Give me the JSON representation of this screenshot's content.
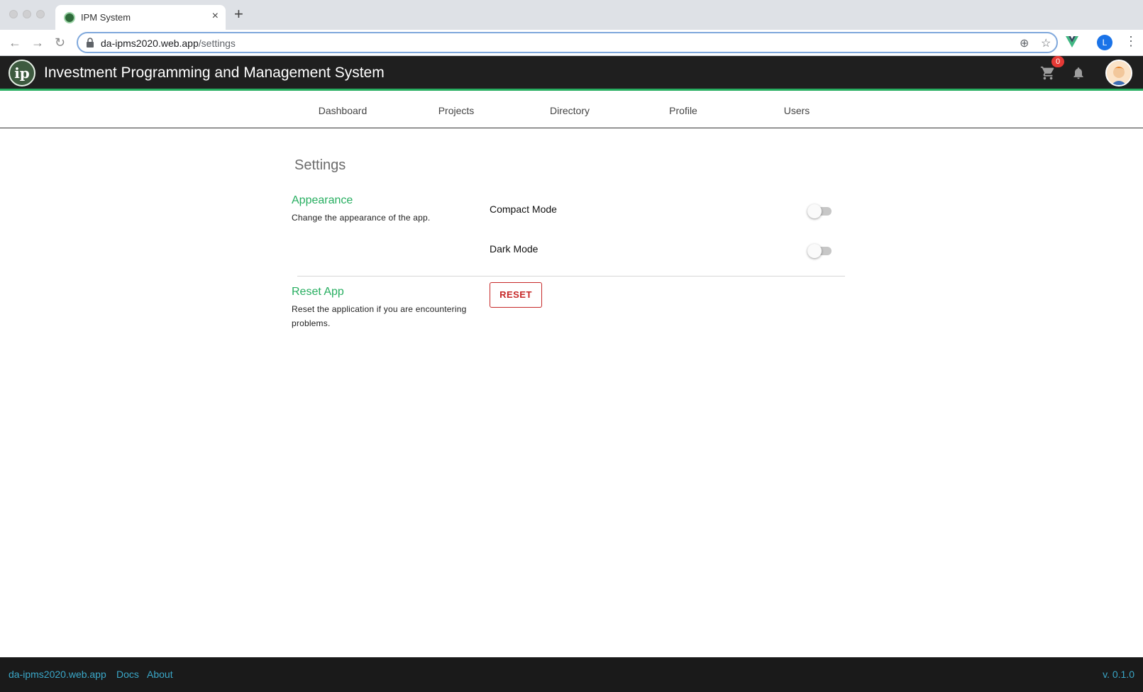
{
  "browser": {
    "tab_title": "IPM System",
    "new_tab_symbol": "+",
    "close_symbol": "×",
    "url_host": "da-ipms2020.web.app",
    "url_path": "/settings",
    "profile_initial": "L"
  },
  "header": {
    "logo_text": "ip",
    "title": "Investment Programming and Management System",
    "cart_count": "0"
  },
  "nav": {
    "items": [
      {
        "label": "Dashboard"
      },
      {
        "label": "Projects"
      },
      {
        "label": "Directory"
      },
      {
        "label": "Profile"
      },
      {
        "label": "Users"
      }
    ]
  },
  "settings": {
    "title": "Settings",
    "appearance": {
      "title": "Appearance",
      "description": "Change the appearance of the app.",
      "compact_mode_label": "Compact Mode",
      "compact_mode_on": false,
      "dark_mode_label": "Dark Mode",
      "dark_mode_on": false
    },
    "reset": {
      "title": "Reset App",
      "description": "Reset the application if you are encountering problems.",
      "button_label": "RESET"
    }
  },
  "footer": {
    "links": [
      {
        "label": "da-ipms2020.web.app"
      },
      {
        "label": "Docs"
      },
      {
        "label": "About"
      }
    ],
    "version": "v. 0.1.0"
  },
  "colors": {
    "accent_green": "#27ae60",
    "danger_red": "#c62828",
    "header_bg": "#1f1f1f",
    "footer_link": "#3aa7c8"
  }
}
